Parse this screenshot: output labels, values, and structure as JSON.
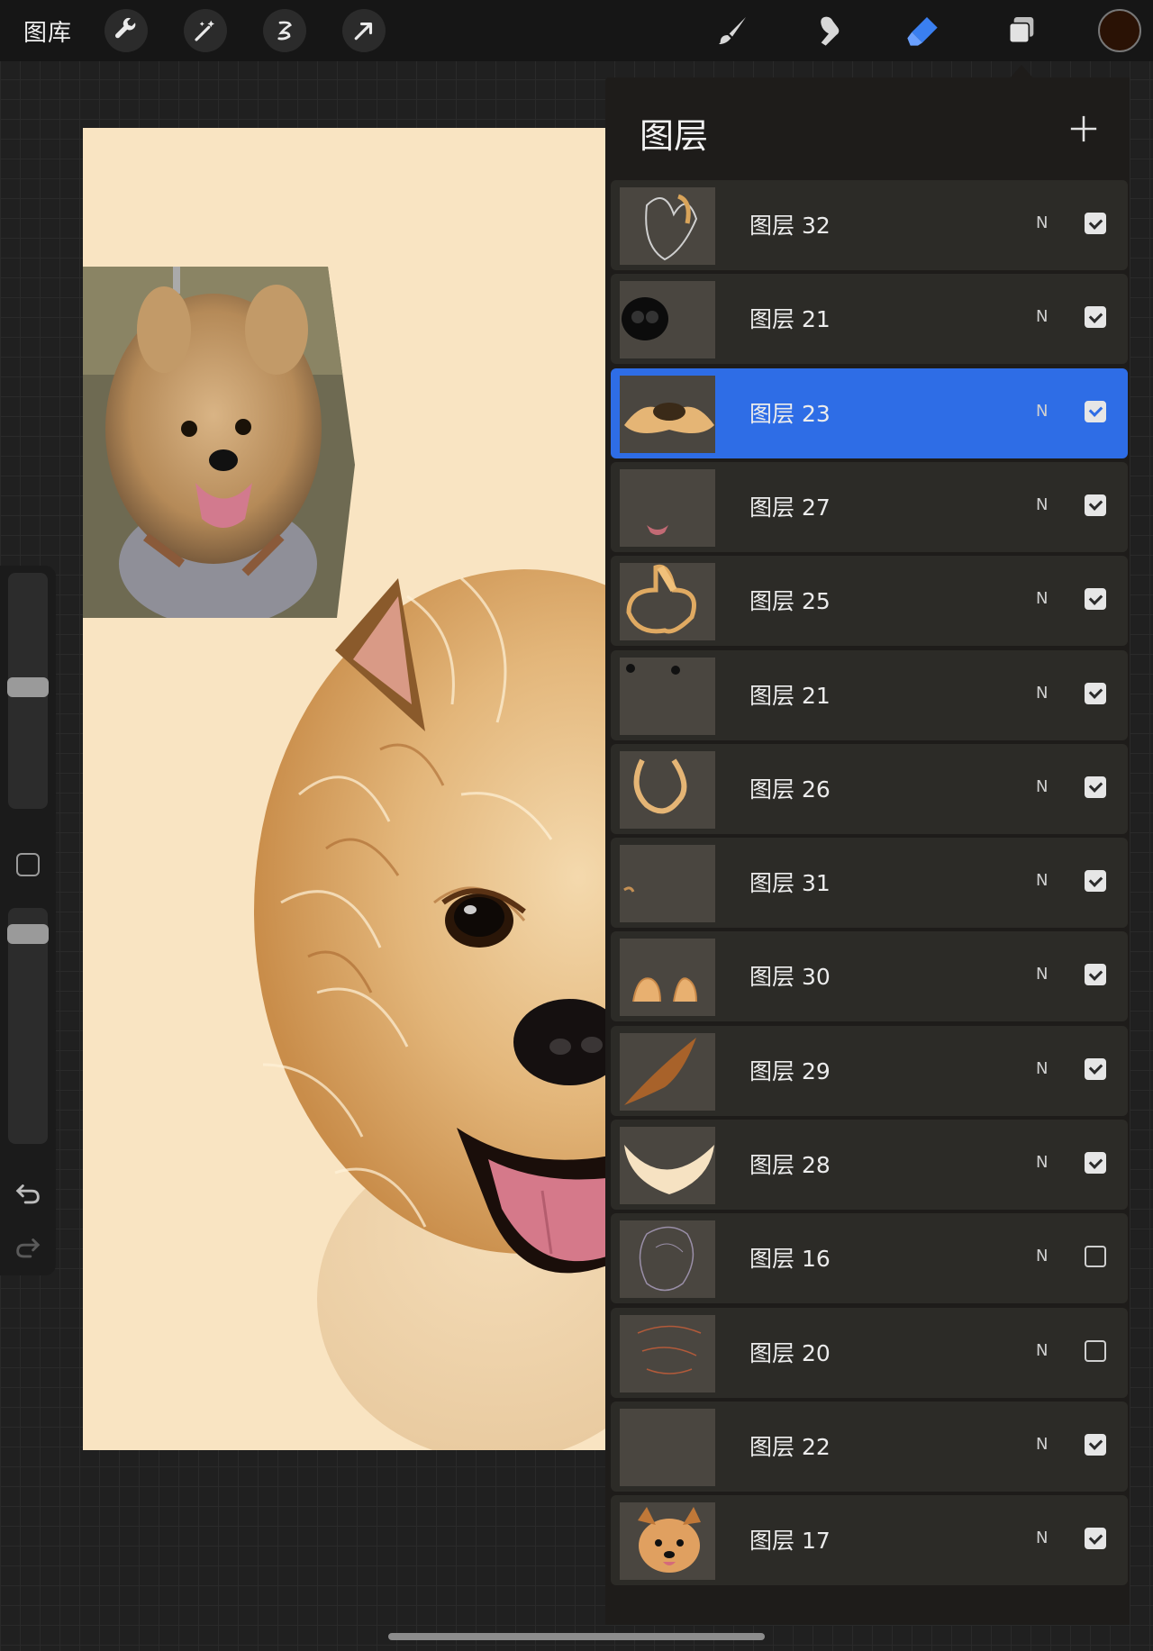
{
  "topbar": {
    "gallery_label": "图库",
    "left_tools": [
      "wrench-icon",
      "magic-wand-icon",
      "selection-icon",
      "transform-arrow-icon"
    ],
    "right_tools": [
      "brush-icon",
      "smudge-icon",
      "eraser-icon",
      "layers-icon"
    ],
    "active_tool": "eraser-icon",
    "current_color": "#2a1205"
  },
  "layers_panel": {
    "title": "图层",
    "layers": [
      {
        "name": "图层 32",
        "blend": "N",
        "visible": true,
        "active": false
      },
      {
        "name": "图层 21",
        "blend": "N",
        "visible": true,
        "active": false
      },
      {
        "name": "图层 23",
        "blend": "N",
        "visible": true,
        "active": true
      },
      {
        "name": "图层 27",
        "blend": "N",
        "visible": true,
        "active": false
      },
      {
        "name": "图层 25",
        "blend": "N",
        "visible": true,
        "active": false
      },
      {
        "name": "图层 21",
        "blend": "N",
        "visible": true,
        "active": false
      },
      {
        "name": "图层 26",
        "blend": "N",
        "visible": true,
        "active": false
      },
      {
        "name": "图层 31",
        "blend": "N",
        "visible": true,
        "active": false
      },
      {
        "name": "图层 30",
        "blend": "N",
        "visible": true,
        "active": false
      },
      {
        "name": "图层 29",
        "blend": "N",
        "visible": true,
        "active": false
      },
      {
        "name": "图层 28",
        "blend": "N",
        "visible": true,
        "active": false
      },
      {
        "name": "图层 16",
        "blend": "N",
        "visible": false,
        "active": false
      },
      {
        "name": "图层 20",
        "blend": "N",
        "visible": false,
        "active": false
      },
      {
        "name": "图层 22",
        "blend": "N",
        "visible": true,
        "active": false
      },
      {
        "name": "图层 17",
        "blend": "N",
        "visible": true,
        "active": false
      }
    ]
  },
  "colors": {
    "accent": "#2e6de6",
    "canvas_bg": "#f9e4c2"
  }
}
